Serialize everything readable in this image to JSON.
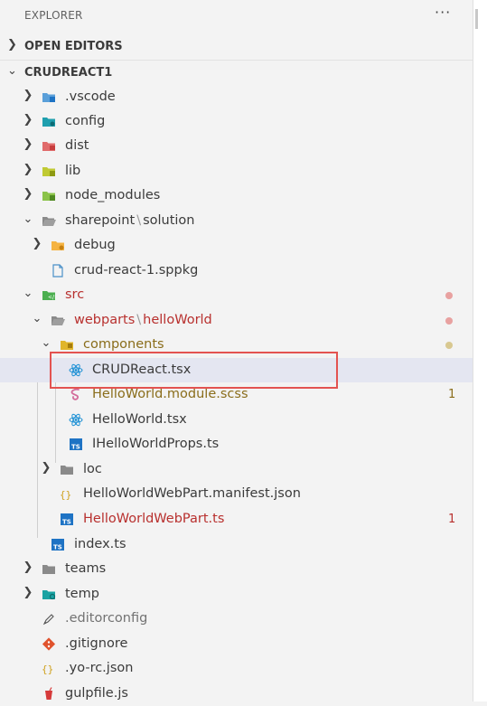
{
  "explorer": {
    "title": "EXPLORER",
    "more_label": "···",
    "open_editors_label": "OPEN EDITORS",
    "project_label": "CRUDREACT1"
  },
  "tree": [
    {
      "label": ".vscode",
      "icon": "folder-vscode-icon",
      "chevron": "right"
    },
    {
      "label": "config",
      "icon": "folder-config-icon",
      "chevron": "right"
    },
    {
      "label": "dist",
      "icon": "folder-dist-icon",
      "chevron": "right"
    },
    {
      "label": "lib",
      "icon": "folder-lib-icon",
      "chevron": "right"
    },
    {
      "label": "node_modules",
      "icon": "folder-node-icon",
      "chevron": "right"
    },
    {
      "label_a": "sharepoint",
      "label_b": "solution",
      "icon": "folder-open-icon",
      "chevron": "down"
    },
    {
      "label": "debug",
      "icon": "folder-debug-icon",
      "chevron": "right"
    },
    {
      "label": "crud-react-1.sppkg",
      "icon": "file-icon"
    },
    {
      "label": "src",
      "icon": "folder-src-icon",
      "chevron": "down",
      "status": "modified"
    },
    {
      "label_a": "webparts",
      "label_b": "helloWorld",
      "icon": "folder-open-icon",
      "chevron": "down",
      "status": "modified"
    },
    {
      "label": "components",
      "icon": "folder-components-icon",
      "chevron": "down",
      "status": "untracked"
    },
    {
      "label": "CRUDReact.tsx",
      "icon": "react-icon",
      "selected": true
    },
    {
      "label": "HelloWorld.module.scss",
      "icon": "sass-icon",
      "badge": "1"
    },
    {
      "label": "HelloWorld.tsx",
      "icon": "react-icon"
    },
    {
      "label": "IHelloWorldProps.ts",
      "icon": "typescript-icon"
    },
    {
      "label": "loc",
      "icon": "folder-icon",
      "chevron": "right"
    },
    {
      "label": "HelloWorldWebPart.manifest.json",
      "icon": "json-icon"
    },
    {
      "label": "HelloWorldWebPart.ts",
      "icon": "typescript-icon",
      "badge": "1"
    },
    {
      "label": "index.ts",
      "icon": "typescript-icon"
    },
    {
      "label": "teams",
      "icon": "folder-icon",
      "chevron": "right"
    },
    {
      "label": "temp",
      "icon": "folder-temp-icon",
      "chevron": "right"
    },
    {
      "label": ".editorconfig",
      "icon": "editorconfig-icon"
    },
    {
      "label": ".gitignore",
      "icon": "git-icon"
    },
    {
      "label": ".yo-rc.json",
      "icon": "json-icon"
    },
    {
      "label": "gulpfile.js",
      "icon": "gulp-icon"
    }
  ],
  "colors": {
    "modified": "#b8302e",
    "untracked": "#8a6d1b",
    "dot_modified": "#e8a1a0",
    "dot_untracked": "#d8c890",
    "highlight": "#e35350",
    "selected": "#e4e6f1"
  }
}
